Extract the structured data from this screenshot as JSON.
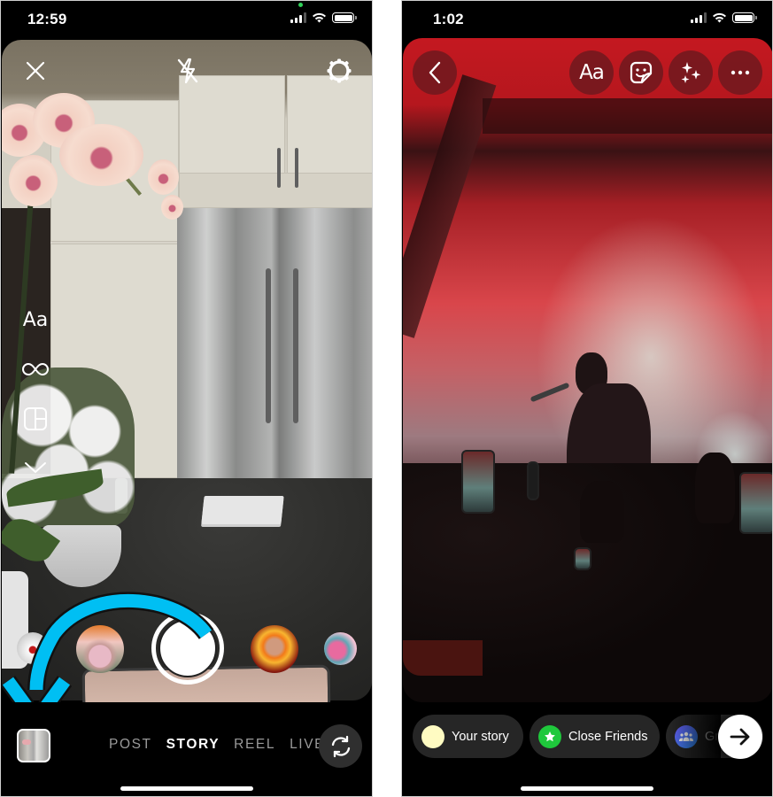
{
  "left_screen": {
    "status_bar": {
      "time": "12:59",
      "mic_indicator_color": "#30d158"
    },
    "camera_toolbar": {
      "close": "close-icon",
      "flash": "flash-off-icon",
      "settings": "settings-gear-icon"
    },
    "side_tools": [
      {
        "name": "create-text",
        "label": "Aa",
        "icon": "text-icon"
      },
      {
        "name": "boomerang",
        "icon": "infinity-icon"
      },
      {
        "name": "layout",
        "icon": "layout-grid-icon"
      },
      {
        "name": "more",
        "icon": "chevron-down-icon"
      }
    ],
    "effects": [
      {
        "name": "eye-effect"
      },
      {
        "name": "doll-effect"
      },
      {
        "name": "capture"
      },
      {
        "name": "fire-effect"
      },
      {
        "name": "flamingo-effect"
      }
    ],
    "modes": [
      {
        "label": "POST",
        "active": false
      },
      {
        "label": "STORY",
        "active": true
      },
      {
        "label": "REEL",
        "active": false
      },
      {
        "label": "LIVE",
        "active": false
      }
    ],
    "gallery": "gallery-thumbnail",
    "flip_camera": "flip-camera-icon",
    "annotation": {
      "type": "curved-arrow",
      "color": "#00bff3",
      "points_to": "gallery-thumbnail"
    }
  },
  "right_screen": {
    "status_bar": {
      "time": "1:02"
    },
    "editor_toolbar": {
      "back": "back-chevron-icon",
      "text_label": "Aa",
      "sticker": "sticker-icon",
      "effects": "sparkles-icon",
      "more": "more-horizontal-icon"
    },
    "share_targets": [
      {
        "label": "Your story",
        "icon_color": "#fffbc2"
      },
      {
        "label": "Close Friends",
        "icon_color": "#1fc83c",
        "icon": "star-icon"
      },
      {
        "label": "Gr",
        "icon_color": "#3d7cf0",
        "icon": "group-icon"
      }
    ],
    "next_button": "arrow-right-icon"
  }
}
